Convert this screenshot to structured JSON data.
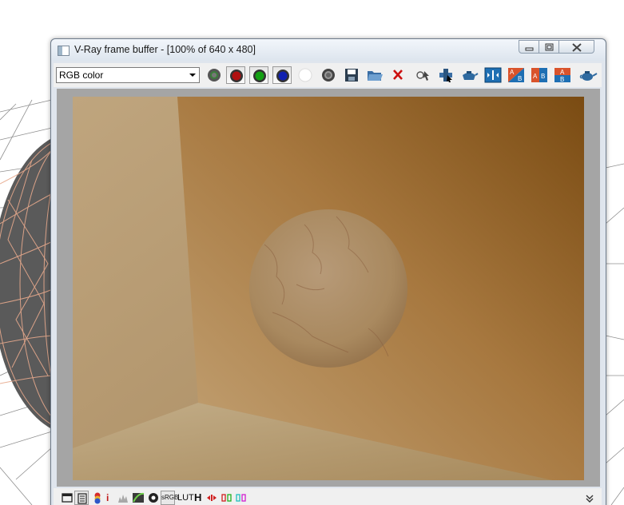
{
  "window": {
    "title": "V-Ray frame buffer - [100% of 640 x 480]",
    "controls": [
      "minimize",
      "restore",
      "close"
    ]
  },
  "toolbar": {
    "channel_select_value": "RGB color",
    "buttons": [
      {
        "name": "rgb-channels-icon",
        "pressed": false
      },
      {
        "name": "red-channel-icon",
        "pressed": true,
        "color": "#cc1111"
      },
      {
        "name": "green-channel-icon",
        "pressed": true,
        "color": "#11aa11"
      },
      {
        "name": "blue-channel-icon",
        "pressed": true,
        "color": "#1122cc"
      },
      {
        "name": "alpha-channel-icon",
        "pressed": false
      },
      {
        "name": "monochrome-icon",
        "pressed": false
      },
      {
        "name": "save-icon",
        "pressed": false
      },
      {
        "name": "open-folder-icon",
        "pressed": false
      },
      {
        "name": "clear-image-icon",
        "pressed": false
      },
      {
        "name": "track-mouse-icon",
        "pressed": false
      },
      {
        "name": "region-render-icon",
        "pressed": false
      },
      {
        "name": "render-last-icon",
        "pressed": false
      },
      {
        "name": "compare-horizontal-icon",
        "pressed": false
      },
      {
        "name": "ab-diagonal-icon",
        "pressed": false
      },
      {
        "name": "ab-horizontal-icon",
        "pressed": false
      },
      {
        "name": "ab-vertical-icon",
        "pressed": false
      },
      {
        "name": "render-teapot-icon",
        "pressed": false
      }
    ]
  },
  "statusbar": {
    "srgb_label": "sRGB",
    "lut_label": "LUT",
    "hdr_label": "H",
    "info_label": "i",
    "items": [
      "display-correction-icon",
      "history-icon",
      "color-corrections-icon",
      "info-icon",
      "levels-icon",
      "curves-icon",
      "exposure-icon",
      "srgb-toggle",
      "lut-toggle",
      "hdr-toggle",
      "pixel-aspect-icon",
      "stereo-red-green-icon",
      "stereo-cyan-magenta-icon",
      "collapse-chevron-icon"
    ]
  },
  "colors": {
    "render_dark": "#7a4b12",
    "render_mid": "#a37945",
    "render_light": "#c8b08a",
    "render_frame": "#a5a5a5"
  }
}
